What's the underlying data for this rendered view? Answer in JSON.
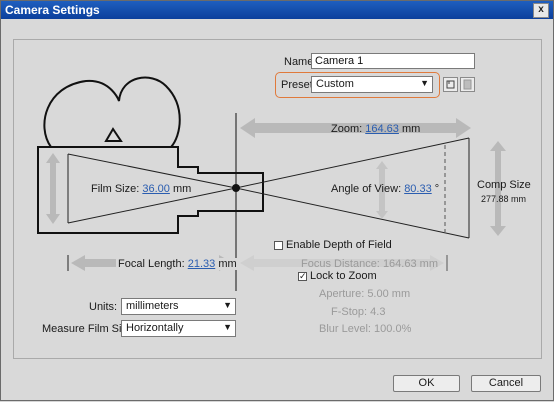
{
  "window": {
    "title": "Camera Settings",
    "close_glyph": "x"
  },
  "name": {
    "label": "Name:",
    "value": "Camera 1"
  },
  "preset": {
    "label": "Preset:",
    "value": "Custom"
  },
  "zoom": {
    "label": "Zoom:",
    "value": "164.63",
    "unit": "mm"
  },
  "film_size": {
    "label": "Film Size:",
    "value": "36.00",
    "unit": "mm"
  },
  "angle_of_view": {
    "label": "Angle of View:",
    "value": "80.33",
    "unit": "°"
  },
  "comp_size": {
    "label": "Comp Size",
    "value": "277.88 mm"
  },
  "focal_length": {
    "label": "Focal Length:",
    "value": "21.33",
    "unit": "mm"
  },
  "depth_of_field": {
    "label": "Enable Depth of Field",
    "checked": false
  },
  "focus_distance": {
    "label": "Focus Distance:",
    "value": "164.63",
    "unit": "mm"
  },
  "lock_to_zoom": {
    "label": "Lock to Zoom",
    "checked": true,
    "check_glyph": "✓"
  },
  "aperture": {
    "label": "Aperture:",
    "value": "5.00",
    "unit": "mm"
  },
  "fstop": {
    "label": "F-Stop:",
    "value": "4.3"
  },
  "blur_level": {
    "label": "Blur Level:",
    "value": "100.0",
    "unit": "%"
  },
  "units": {
    "label": "Units:",
    "value": "millimeters"
  },
  "measure_film_size": {
    "label": "Measure Film Size:",
    "value": "Horizontally"
  },
  "buttons": {
    "ok": "OK",
    "cancel": "Cancel"
  },
  "icons": {
    "dropdown": "▼",
    "preset_save": "save-preset-icon",
    "preset_delete": "delete-preset-icon"
  },
  "colors": {
    "accent_link": "#2a5db0",
    "preset_highlight": "#e07a3c",
    "titlebar": "#1f5fbf"
  }
}
